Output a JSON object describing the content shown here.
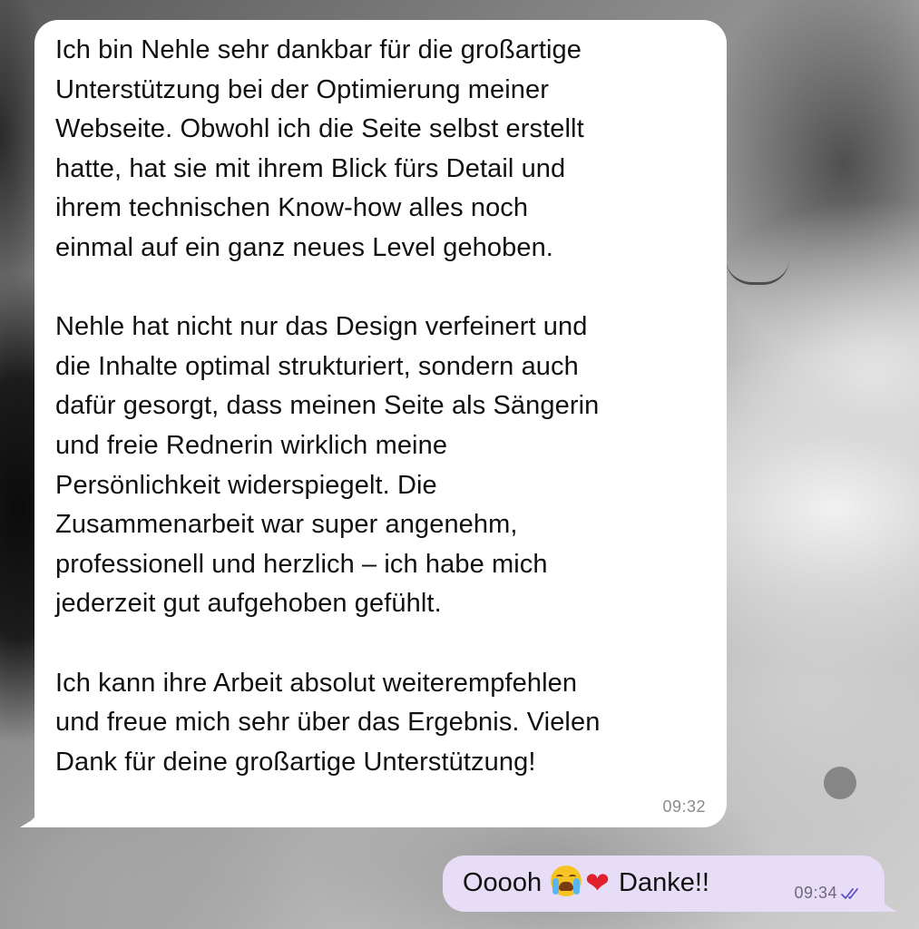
{
  "messages": {
    "received": {
      "text": "Ich bin Nehle sehr dankbar für die großartige\nUnterstützung bei der Optimierung meiner\nWebseite. Obwohl ich die Seite selbst erstellt\nhatte, hat sie mit ihrem Blick fürs Detail und\nihrem technischen Know-how alles noch\neinmal auf ein ganz neues Level gehoben.\n\nNehle hat nicht nur das Design verfeinert und\ndie Inhalte optimal strukturiert, sondern auch\ndafür gesorgt, dass meinen Seite als Sängerin\nund freie Rednerin wirklich meine\nPersönlichkeit widerspiegelt. Die\nZusammenarbeit war super angenehm,\nprofessionell und herzlich – ich habe mich\njederzeit gut aufgehoben gefühlt.\n\nIch kann ihre Arbeit absolut weiterempfehlen\nund freue mich sehr über das Ergebnis. Vielen\nDank für deine großartige Unterstützung!",
      "time": "09:32"
    },
    "sent": {
      "text_before": "Ooooh",
      "emojis": [
        "loudly-crying-face-emoji",
        "red-heart-emoji"
      ],
      "heart_glyph": "❤",
      "text_after": "Danke!!",
      "time": "09:34",
      "status": "read",
      "status_icon": "double-check-icon"
    }
  },
  "colors": {
    "incoming_bubble": "#ffffff",
    "outgoing_bubble": "#e7ddf7",
    "read_check": "#5b4fc9"
  }
}
